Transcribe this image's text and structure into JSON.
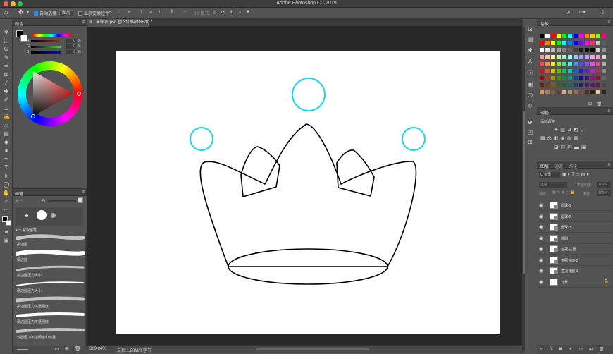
{
  "app": {
    "title": "Adobe Photoshop CC 2019"
  },
  "options_bar": {
    "auto_select_label": "自动选择:",
    "auto_select_value": "图层",
    "show_transform_label": "显示变换控件",
    "mode_3d_label": "3D 模式:"
  },
  "document": {
    "tab_label": "未命名.psd @ 310%(RGB/8) *",
    "zoom_status": "309.84%",
    "doc_size": "文档:1.28M/0 字节"
  },
  "panels": {
    "color": {
      "title": "颜色",
      "rgb": [
        {
          "ch": "R",
          "value": "0"
        },
        {
          "ch": "G",
          "value": "0"
        },
        {
          "ch": "B",
          "value": "0"
        }
      ],
      "percent": "%"
    },
    "brush": {
      "title": "画笔",
      "size_label": "大小:",
      "folder": "常规画笔",
      "presets": [
        "柔边圆",
        "硬边圆",
        "柔边圆压力大小",
        "硬边圆压力大小",
        "柔边圆压力不透明度",
        "硬边圆压力不透明度",
        "软圆压力不透明度和流量"
      ]
    },
    "swatches": {
      "title": "色板"
    },
    "adjustments": {
      "title": "调整",
      "add_label": "添加调整"
    },
    "layers": {
      "tabs": [
        "图层",
        "通道",
        "路径"
      ],
      "kind_label": "Q 类型",
      "blend_mode": "正常",
      "opacity_label": "不透明度:",
      "opacity_value": "100%",
      "lock_label": "锁定:",
      "fill_label": "填充:",
      "fill_value": "100%",
      "items": [
        "圆球-1",
        "圆球-2",
        "圆球-3",
        "椭圆",
        "皇冠-主圈",
        "皇冠背面-2",
        "皇冠背面-1",
        "背景"
      ]
    }
  },
  "colors": {
    "accent": "#2f8bea",
    "circle_stroke": "#19d8e6",
    "crown_stroke": "#000000"
  }
}
